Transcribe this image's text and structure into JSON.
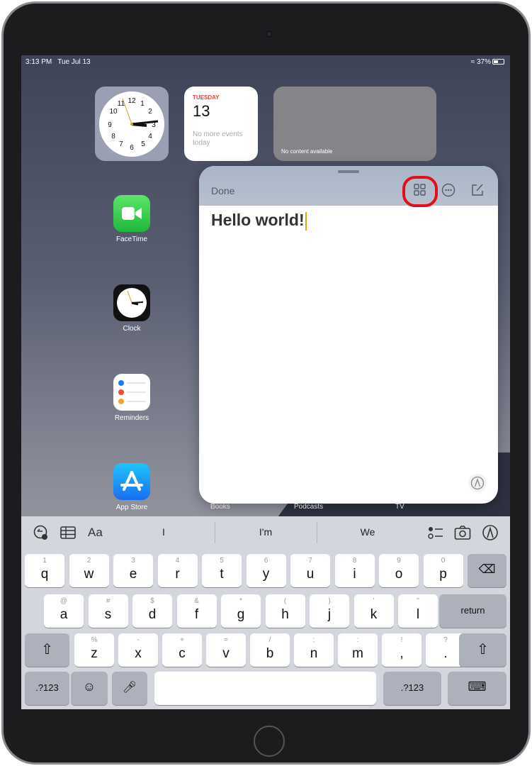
{
  "status": {
    "time": "3:13 PM",
    "date": "Tue Jul 13",
    "battery": "37%",
    "battery_level": 0.37
  },
  "widgets": {
    "calendar": {
      "day": "TUESDAY",
      "date": "13",
      "message": "No more events today"
    },
    "empty": {
      "message": "No content available"
    }
  },
  "apps": [
    {
      "label": "FaceTime"
    },
    {
      "label": "Clock"
    },
    {
      "label": "Reminders"
    },
    {
      "label": "App Store"
    }
  ],
  "dock": [
    {
      "label": "Books"
    },
    {
      "label": "Podcasts"
    },
    {
      "label": "TV"
    }
  ],
  "notes": {
    "done_label": "Done",
    "content": "Hello world!",
    "highlight_color": "#e0101a"
  },
  "keyboard": {
    "suggestions": [
      "I",
      "I'm",
      "We"
    ],
    "format_label": "Aa",
    "row1": [
      {
        "s": "1",
        "m": "q"
      },
      {
        "s": "2",
        "m": "w"
      },
      {
        "s": "3",
        "m": "e"
      },
      {
        "s": "4",
        "m": "r"
      },
      {
        "s": "5",
        "m": "t"
      },
      {
        "s": "6",
        "m": "y"
      },
      {
        "s": "7",
        "m": "u"
      },
      {
        "s": "8",
        "m": "i"
      },
      {
        "s": "9",
        "m": "o"
      },
      {
        "s": "0",
        "m": "p"
      }
    ],
    "row2": [
      {
        "s": "@",
        "m": "a"
      },
      {
        "s": "#",
        "m": "s"
      },
      {
        "s": "$",
        "m": "d"
      },
      {
        "s": "&",
        "m": "f"
      },
      {
        "s": "*",
        "m": "g"
      },
      {
        "s": "(",
        "m": "h"
      },
      {
        "s": ")",
        "m": "j"
      },
      {
        "s": "'",
        "m": "k"
      },
      {
        "s": "\"",
        "m": "l"
      }
    ],
    "row3": [
      {
        "s": "%",
        "m": "z"
      },
      {
        "s": "-",
        "m": "x"
      },
      {
        "s": "+",
        "m": "c"
      },
      {
        "s": "=",
        "m": "v"
      },
      {
        "s": "/",
        "m": "b"
      },
      {
        "s": ";",
        "m": "n"
      },
      {
        "s": ":",
        "m": "m"
      },
      {
        "s": "!",
        "m": ","
      },
      {
        "s": "?",
        "m": "."
      }
    ],
    "return_label": "return",
    "numbers_label": ".?123"
  }
}
